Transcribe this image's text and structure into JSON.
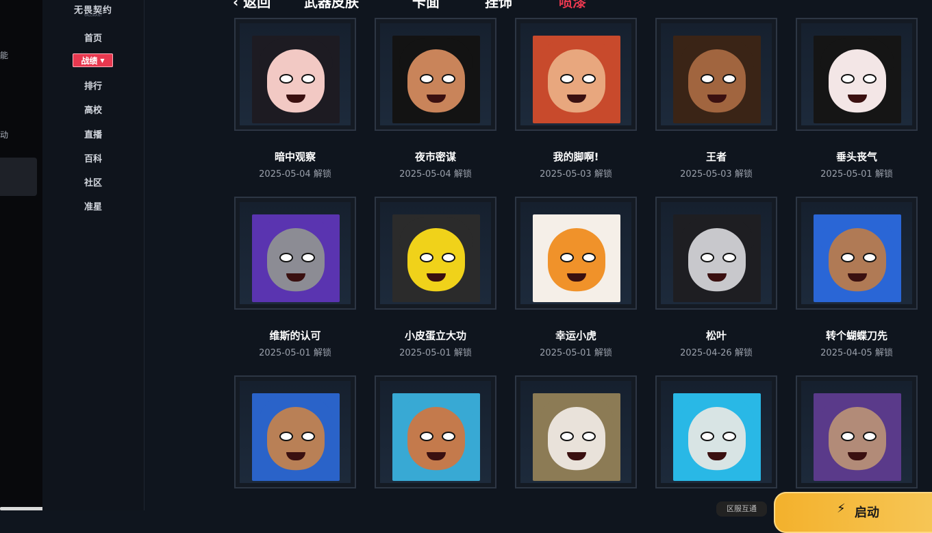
{
  "left_edge": {
    "text_1": "能",
    "text_2": "动"
  },
  "sidebar": {
    "logo": "无畏契约",
    "logo_sub": "VALORANT",
    "items": [
      "首页",
      "战绩",
      "排行",
      "高校",
      "直播",
      "百科",
      "社区",
      "准星"
    ],
    "active_index": 1
  },
  "topnav": {
    "back": "‹ 返回",
    "tabs": [
      "武器皮肤",
      "卡面",
      "挂饰",
      "喷漆"
    ],
    "active_tab": "喷漆",
    "active_color": "#e8384f"
  },
  "sprays": [
    {
      "name": "暗中观察",
      "date": "2025-05-04 解锁",
      "palette": [
        "#f2c9c4",
        "#1d1b22"
      ]
    },
    {
      "name": "夜市密谋",
      "date": "2025-05-04 解锁",
      "palette": [
        "#c9845a",
        "#131313"
      ]
    },
    {
      "name": "我的脚啊!",
      "date": "2025-05-03 解锁",
      "palette": [
        "#e8a77e",
        "#c84a2c"
      ]
    },
    {
      "name": "王者",
      "date": "2025-05-03 解锁",
      "palette": [
        "#a1653f",
        "#3a2416"
      ]
    },
    {
      "name": "垂头丧气",
      "date": "2025-05-01 解锁",
      "palette": [
        "#f3e6e6",
        "#151515"
      ]
    },
    {
      "name": "维斯的认可",
      "date": "2025-05-01 解锁",
      "palette": [
        "#8c8c94",
        "#5a34b0"
      ]
    },
    {
      "name": "小皮蛋立大功",
      "date": "2025-05-01 解锁",
      "palette": [
        "#f0d21a",
        "#2b2b2b"
      ]
    },
    {
      "name": "幸运小虎",
      "date": "2025-05-01 解锁",
      "palette": [
        "#f0922a",
        "#f5efe8"
      ]
    },
    {
      "name": "松叶",
      "date": "2025-04-26 解锁",
      "palette": [
        "#c8c8cc",
        "#1e1e22"
      ]
    },
    {
      "name": "转个蝴蝶刀先",
      "date": "2025-04-05 解锁",
      "palette": [
        "#b07a55",
        "#2a66d6"
      ]
    },
    {
      "name": "",
      "date": "",
      "palette": [
        "#b98056",
        "#2a63c9"
      ]
    },
    {
      "name": "",
      "date": "",
      "palette": [
        "#c47a4c",
        "#38a9d4"
      ]
    },
    {
      "name": "",
      "date": "",
      "palette": [
        "#e9e2da",
        "#8c7b55"
      ]
    },
    {
      "name": "",
      "date": "",
      "palette": [
        "#d8e4e4",
        "#29b8e6"
      ]
    },
    {
      "name": "",
      "date": "",
      "palette": [
        "#b28b78",
        "#5a3a8a"
      ]
    }
  ],
  "floating": {
    "server_pill": "区服互通",
    "start_button": "启动"
  }
}
